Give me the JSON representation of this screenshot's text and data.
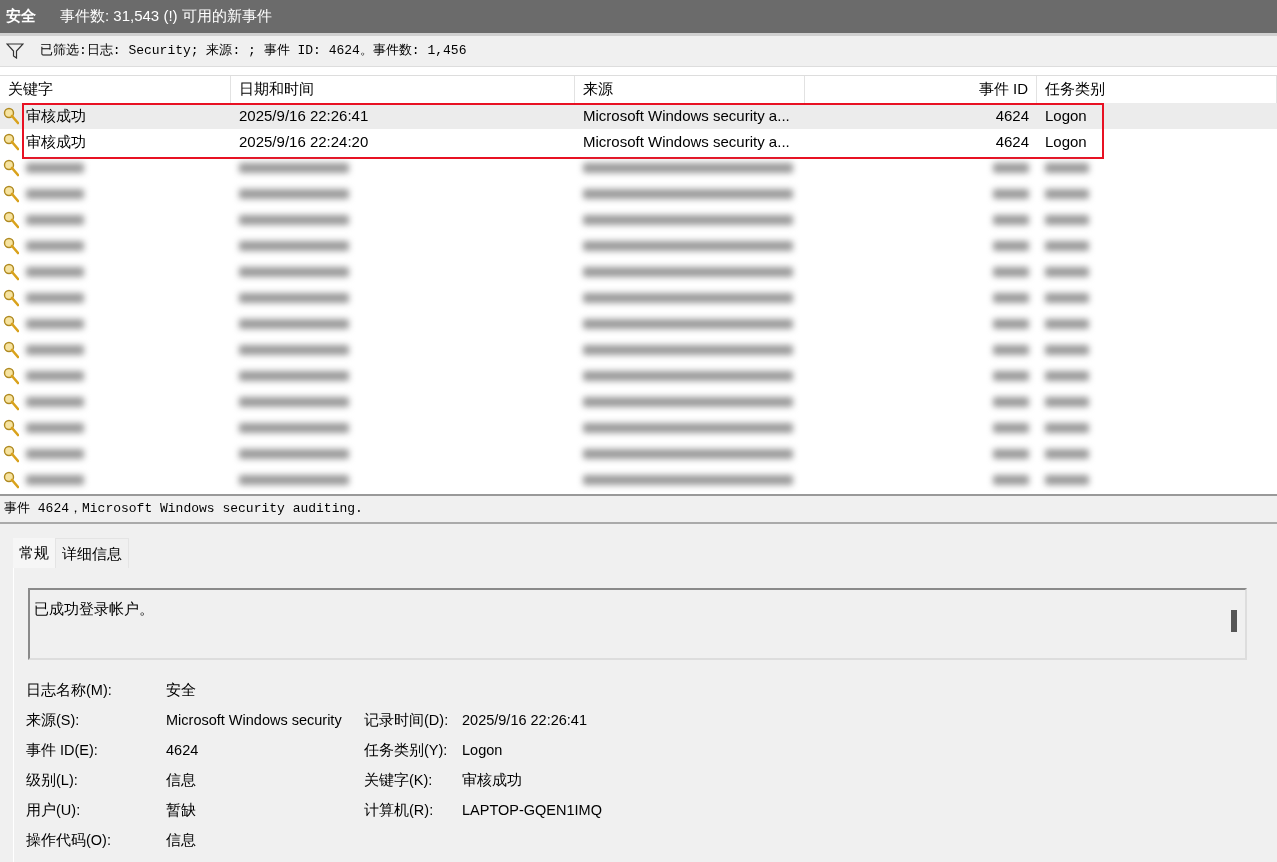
{
  "header": {
    "title": "安全",
    "subtitle": "事件数: 31,543 (!) 可用的新事件"
  },
  "filter_bar": {
    "text": "已筛选:日志: Security; 来源: ; 事件 ID: 4624。事件数: 1,456"
  },
  "table": {
    "columns": [
      "关键字",
      "日期和时间",
      "来源",
      "事件 ID",
      "任务类别"
    ],
    "rows": [
      {
        "kind": "event",
        "selected": true,
        "highlighted": true,
        "keyword": "审核成功",
        "datetime": "2025/9/16 22:26:41",
        "source": "Microsoft Windows security a...",
        "event_id": "4624",
        "category": "Logon"
      },
      {
        "kind": "event",
        "selected": false,
        "highlighted": true,
        "keyword": "审核成功",
        "datetime": "2025/9/16 22:24:20",
        "source": "Microsoft Windows security a...",
        "event_id": "4624",
        "category": "Logon"
      },
      {
        "kind": "blurred"
      },
      {
        "kind": "blurred"
      },
      {
        "kind": "blurred"
      },
      {
        "kind": "blurred"
      },
      {
        "kind": "blurred"
      },
      {
        "kind": "blurred"
      },
      {
        "kind": "blurred"
      },
      {
        "kind": "blurred"
      },
      {
        "kind": "blurred"
      },
      {
        "kind": "blurred"
      },
      {
        "kind": "blurred"
      },
      {
        "kind": "blurred"
      },
      {
        "kind": "blurred"
      }
    ]
  },
  "detail": {
    "title": "事件 4624，Microsoft Windows security auditing.",
    "tabs": [
      {
        "label": "常规",
        "selected": true
      },
      {
        "label": "详细信息",
        "selected": false
      }
    ],
    "description": "已成功登录帐户。",
    "fields": [
      {
        "left": {
          "label": "日志名称(M):",
          "value": "安全"
        }
      },
      {
        "left": {
          "label": "来源(S):",
          "value": "Microsoft Windows security"
        },
        "right": {
          "label": "记录时间(D):",
          "value": "2025/9/16 22:26:41"
        }
      },
      {
        "left": {
          "label": "事件 ID(E):",
          "value": "4624"
        },
        "right": {
          "label": "任务类别(Y):",
          "value": "Logon"
        }
      },
      {
        "left": {
          "label": "级别(L):",
          "value": "信息"
        },
        "right": {
          "label": "关键字(K):",
          "value": "审核成功"
        }
      },
      {
        "left": {
          "label": "用户(U):",
          "value": "暂缺"
        },
        "right": {
          "label": "计算机(R):",
          "value": "LAPTOP-GQEN1IMQ"
        }
      },
      {
        "left": {
          "label": "操作代码(O):",
          "value": "信息"
        }
      }
    ]
  }
}
